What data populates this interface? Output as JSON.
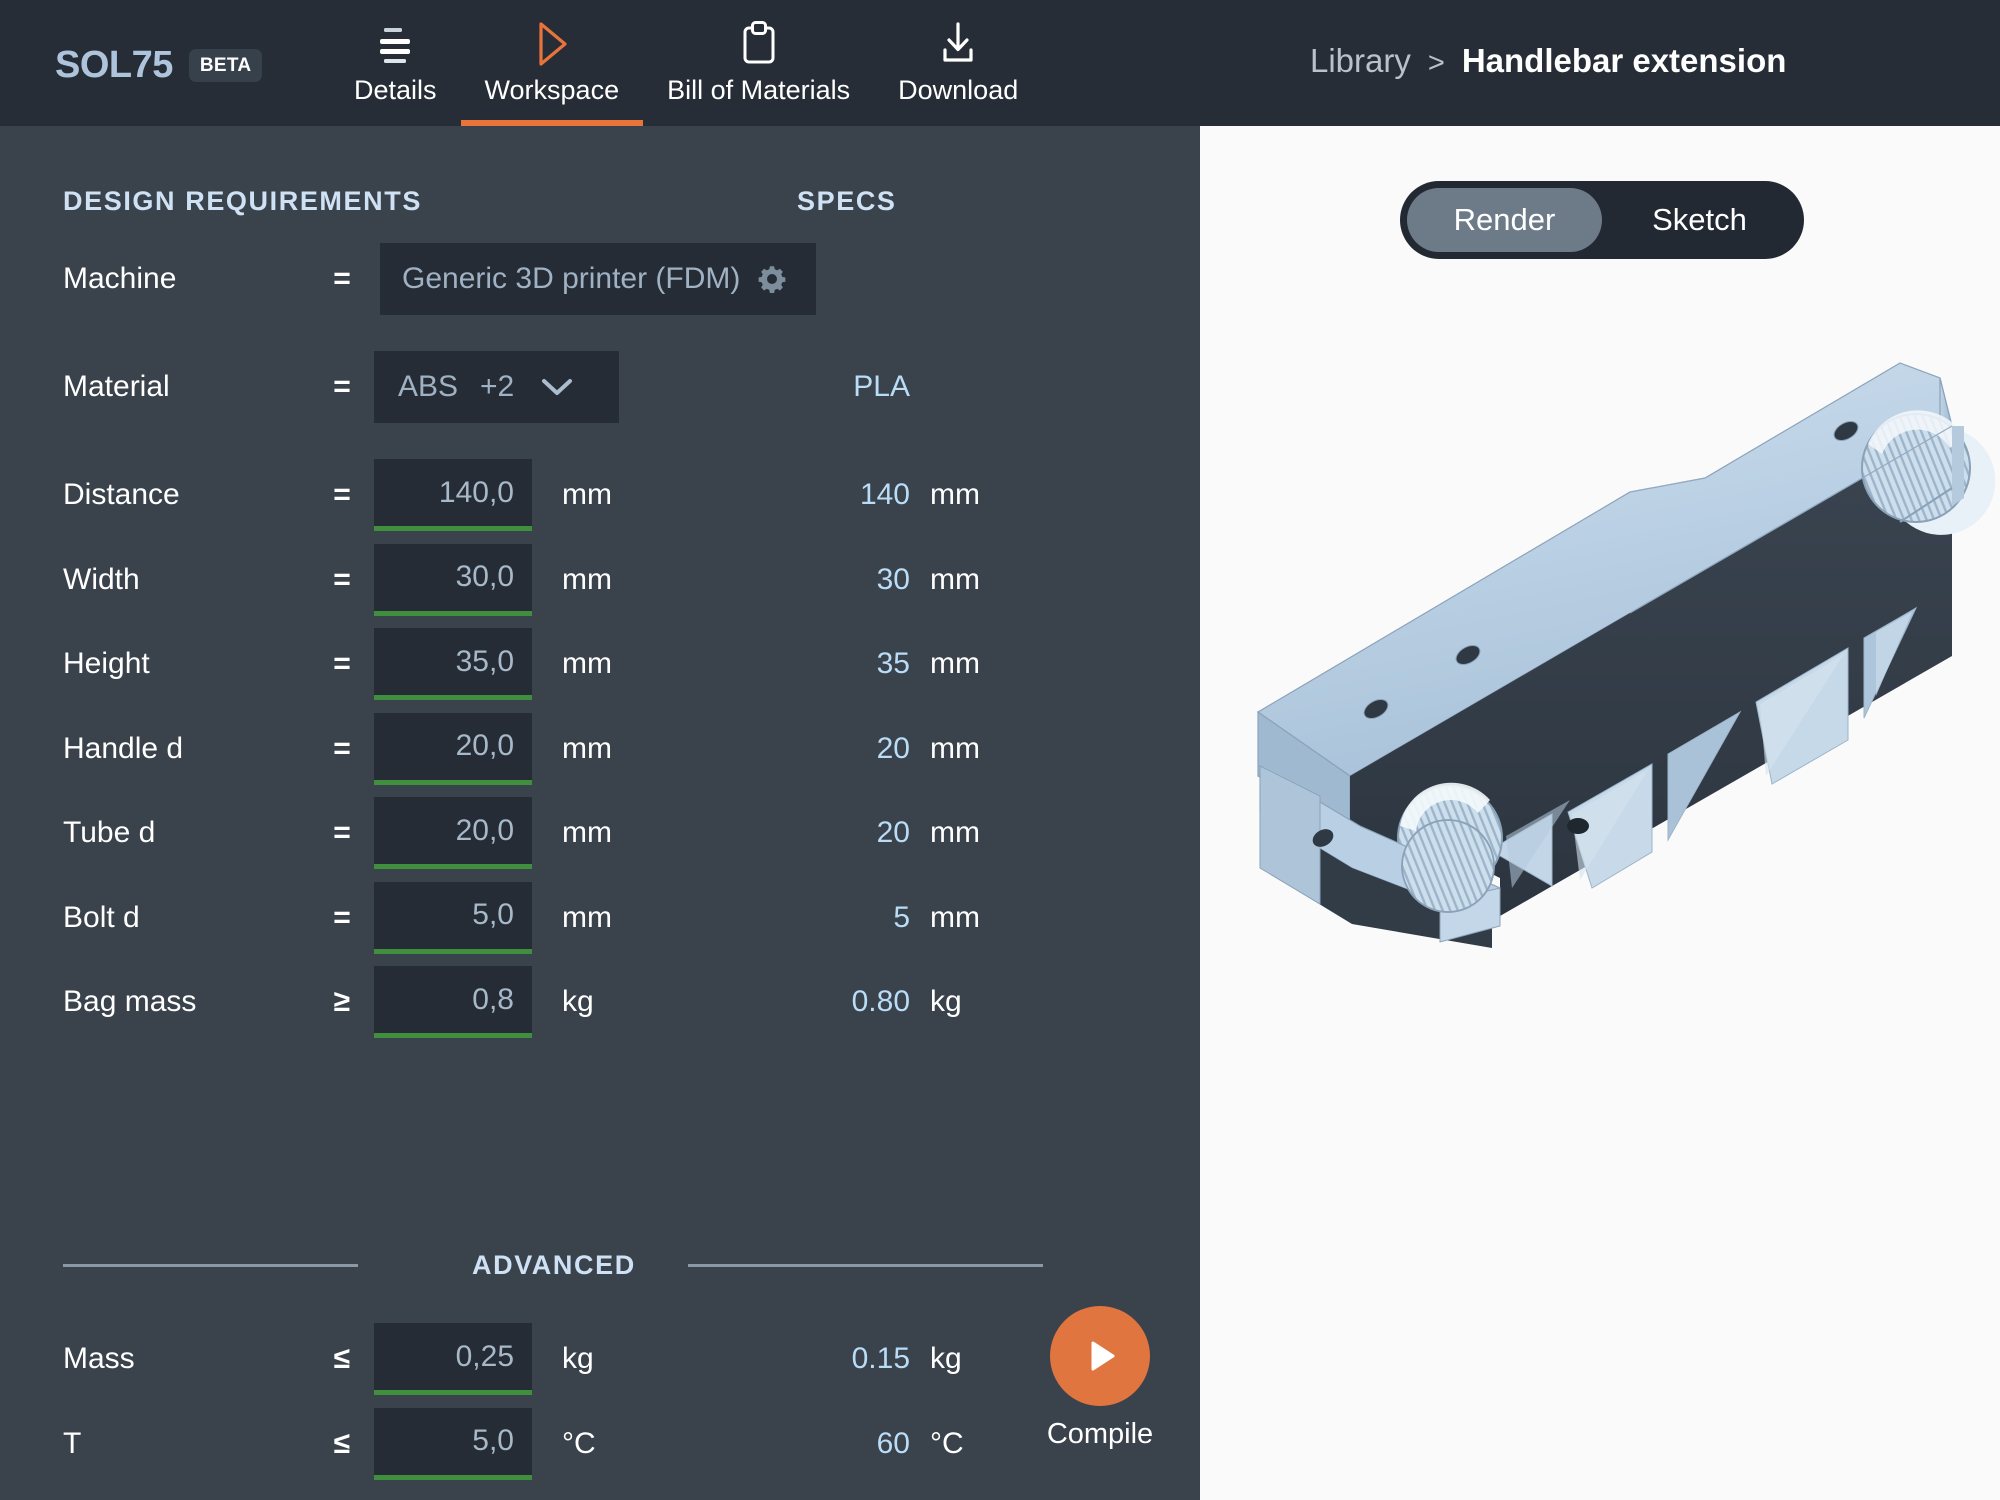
{
  "header": {
    "brand": "SOL75",
    "badge": "BETA",
    "tabs": [
      {
        "label": "Details",
        "icon": "lines-icon",
        "active": false
      },
      {
        "label": "Workspace",
        "icon": "play-outline-icon",
        "active": true
      },
      {
        "label": "Bill of Materials",
        "icon": "clipboard-icon",
        "active": false
      },
      {
        "label": "Download",
        "icon": "download-icon",
        "active": false
      }
    ],
    "breadcrumb": {
      "root": "Library",
      "separator": ">",
      "current": "Handlebar extension"
    }
  },
  "left_panel": {
    "col_design": "DESIGN REQUIREMENTS",
    "col_specs": "SPECS",
    "advanced_divider": "ADVANCED",
    "machine": {
      "label": "Machine",
      "operator": "=",
      "value": "Generic 3D printer (FDM)",
      "settings_icon": "gear-icon"
    },
    "material": {
      "label": "Material",
      "operator": "=",
      "value": "ABS",
      "extra": "+2",
      "chevron": "chevron-down-icon",
      "spec": "PLA"
    },
    "parameters": [
      {
        "label": "Distance",
        "operator": "=",
        "value": "140,0",
        "unit": "mm",
        "spec": "140",
        "spec_unit": "mm"
      },
      {
        "label": "Width",
        "operator": "=",
        "value": "30,0",
        "unit": "mm",
        "spec": "30",
        "spec_unit": "mm"
      },
      {
        "label": "Height",
        "operator": "=",
        "value": "35,0",
        "unit": "mm",
        "spec": "35",
        "spec_unit": "mm"
      },
      {
        "label": "Handle d",
        "operator": "=",
        "value": "20,0",
        "unit": "mm",
        "spec": "20",
        "spec_unit": "mm"
      },
      {
        "label": "Tube d",
        "operator": "=",
        "value": "20,0",
        "unit": "mm",
        "spec": "20",
        "spec_unit": "mm"
      },
      {
        "label": "Bolt d",
        "operator": "=",
        "value": "5,0",
        "unit": "mm",
        "spec": "5",
        "spec_unit": "mm"
      },
      {
        "label": "Bag mass",
        "operator": "≥",
        "value": "0,8",
        "unit": "kg",
        "spec": "0.80",
        "spec_unit": "kg"
      }
    ],
    "advanced_parameters": [
      {
        "label": "Mass",
        "operator": "≤",
        "value": "0,25",
        "unit": "kg",
        "spec": "0.15",
        "spec_unit": "kg"
      },
      {
        "label": "T",
        "operator": "≤",
        "value": "5,0",
        "unit": "°C",
        "spec": "60",
        "spec_unit": "°C"
      }
    ],
    "compile": {
      "label": "Compile",
      "icon": "play-icon"
    }
  },
  "right_panel": {
    "view_toggle": {
      "options": [
        "Render",
        "Sketch"
      ],
      "selected": "Render"
    },
    "model": {
      "name": "handlebar-extension-3d-model"
    }
  },
  "colors": {
    "header_bg": "#262d36",
    "panel_bg": "#3a424b",
    "field_bg": "#252c35",
    "accent": "#e8743b",
    "valid_underline": "#3f8f3f",
    "spec_text": "#b9dcf7",
    "viewer_bg": "#fafafa"
  }
}
